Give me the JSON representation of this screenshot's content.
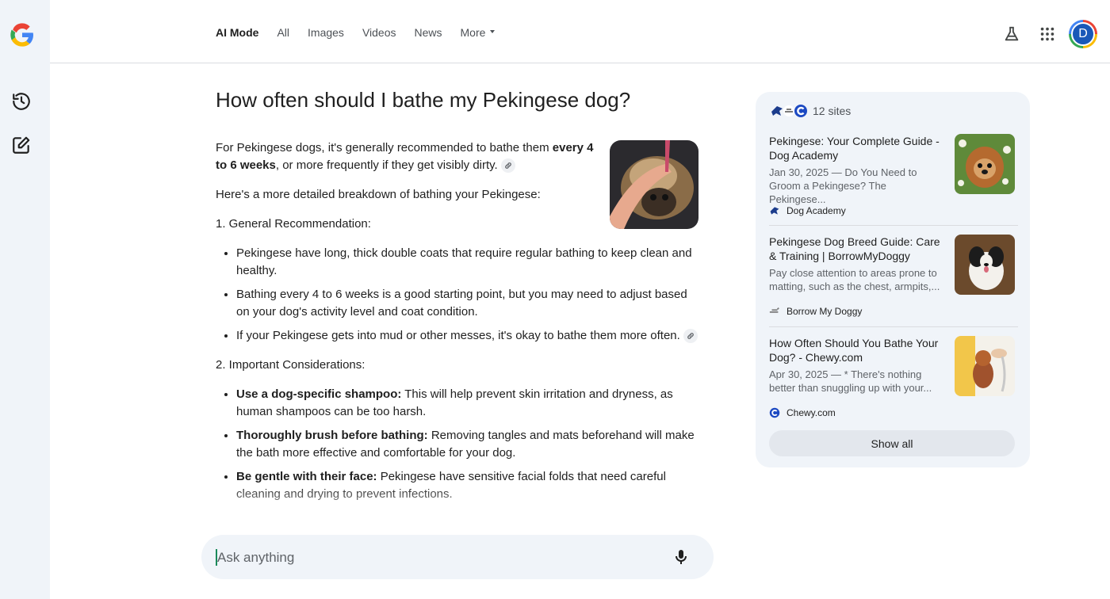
{
  "nav": {
    "tabs": [
      {
        "label": "AI Mode",
        "active": true
      },
      {
        "label": "All"
      },
      {
        "label": "Images"
      },
      {
        "label": "Videos"
      },
      {
        "label": "News"
      },
      {
        "label": "More"
      }
    ],
    "avatar_initial": "D"
  },
  "answer": {
    "question": "How often should I bathe my Pekingese dog?",
    "intro_a": "For Pekingese dogs, it's generally recommended to bathe them ",
    "intro_bold": "every 4 to 6 weeks",
    "intro_b": ", or more frequently if they get visibly dirty.",
    "breakdown": "Here's a more detailed breakdown of bathing your Pekingese:",
    "section1": "1. General Recommendation:",
    "section1_items": [
      "Pekingese have long, thick double coats that require regular bathing to keep clean and healthy.",
      "Bathing every 4 to 6 weeks is a good starting point, but you may need to adjust based on your dog's activity level and coat condition.",
      "If your Pekingese gets into mud or other messes, it's okay to bathe them more often."
    ],
    "section2": "2. Important Considerations:",
    "section2_items": [
      {
        "bold": "Use a dog-specific shampoo:",
        "text": " This will help prevent skin irritation and dryness, as human shampoos can be too harsh."
      },
      {
        "bold": "Thoroughly brush before bathing:",
        "text": " Removing tangles and mats beforehand will make the bath more effective and comfortable for your dog."
      },
      {
        "bold": "Be gentle with their face:",
        "text": " Pekingese have sensitive facial folds that need careful cleaning and drying to prevent infections."
      }
    ]
  },
  "sources": {
    "count_label": "12 sites",
    "items": [
      {
        "title": "Pekingese: Your Complete Guide - Dog Academy",
        "snippet": "Jan 30, 2025 — Do You Need to Groom a Pekingese? The Pekingese...",
        "site": "Dog Academy",
        "icon": "dog-academy-icon"
      },
      {
        "title": "Pekingese Dog Breed Guide: Care & Training | BorrowMyDoggy",
        "snippet": "Pay close attention to areas prone to matting, such as the chest, armpits,...",
        "site": "Borrow My Doggy",
        "icon": "borrow-my-doggy-icon"
      },
      {
        "title": "How Often Should You Bathe Your Dog? - Chewy.com",
        "snippet": "Apr 30, 2025 — * There's nothing better than snuggling up with your...",
        "site": "Chewy.com",
        "icon": "chewy-icon"
      }
    ],
    "show_all": "Show all"
  },
  "ask": {
    "placeholder": "Ask anything"
  },
  "colors": {
    "rail_bg": "#f0f4f9",
    "panel_bg": "#f0f4f9",
    "avatar": "#1a58b8",
    "chewy_blue": "#1c49c2"
  }
}
